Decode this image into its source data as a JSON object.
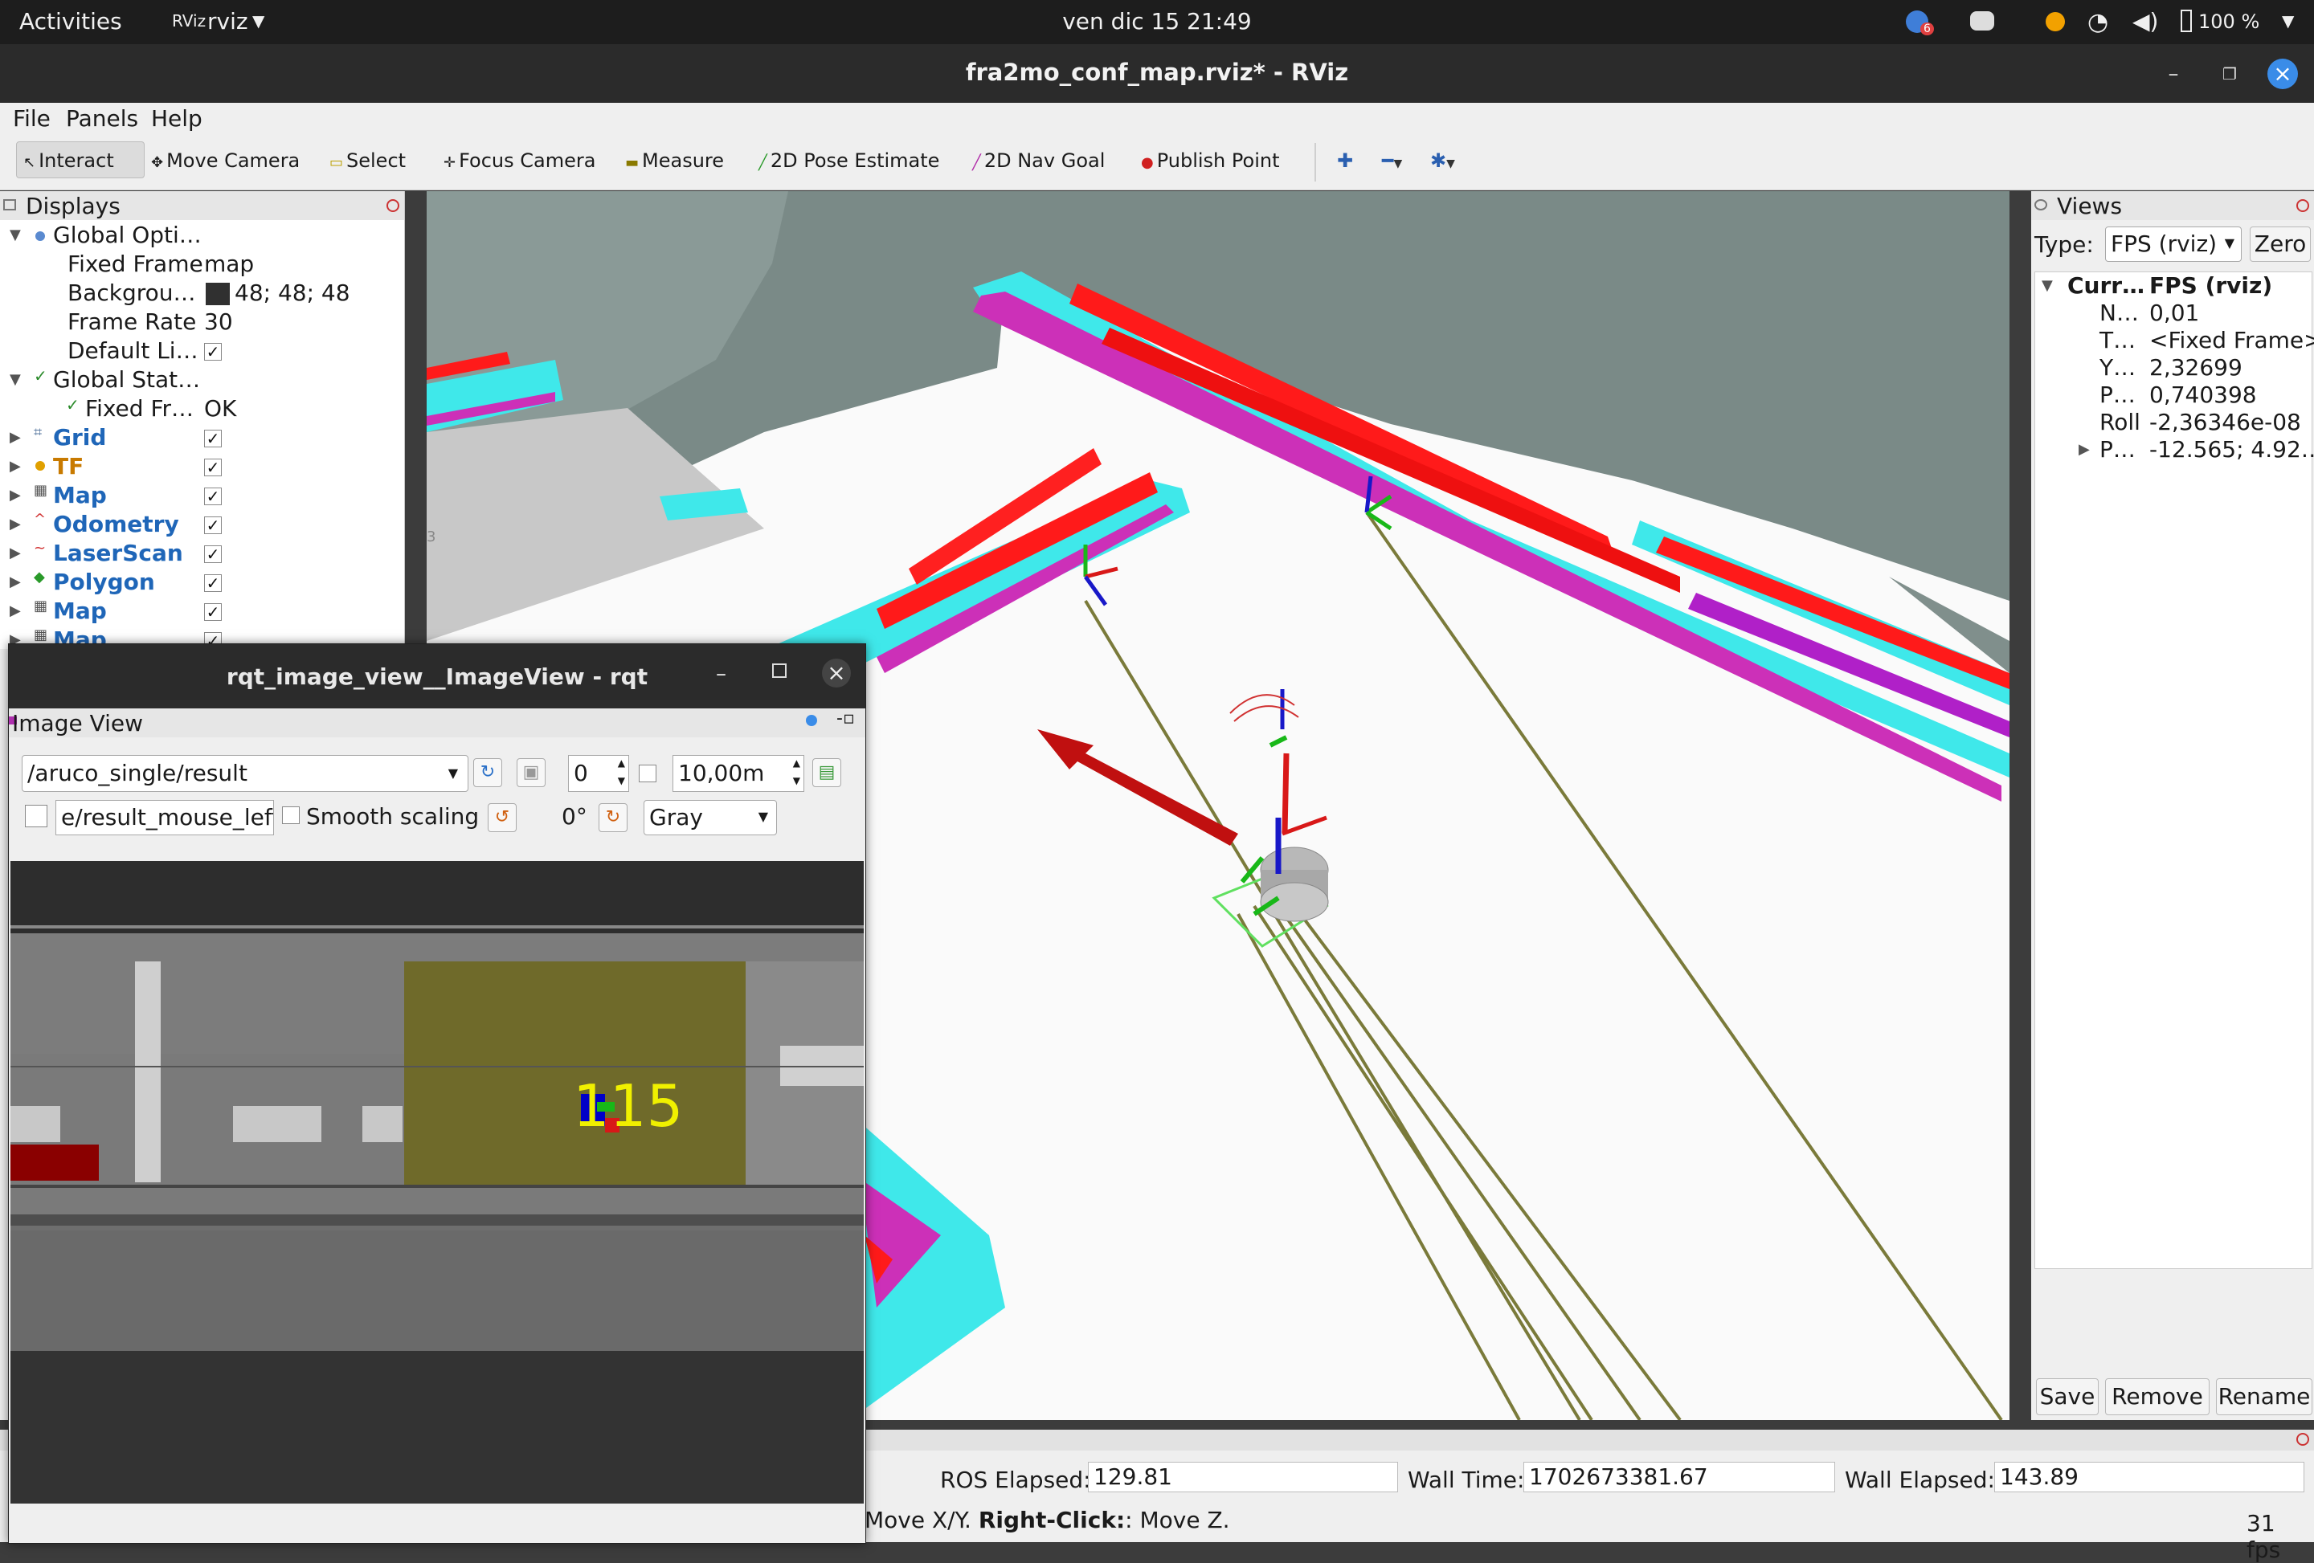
{
  "topbar": {
    "activities": "Activities",
    "app_name": "rviz",
    "clock": "ven dic 15  21:49",
    "battery": "100 %",
    "notif_count": "6"
  },
  "window": {
    "title": "fra2mo_conf_map.rviz* - RViz"
  },
  "menu": {
    "file": "File",
    "panels": "Panels",
    "help": "Help"
  },
  "toolbar": {
    "interact": "Interact",
    "move_camera": "Move Camera",
    "select": "Select",
    "focus_camera": "Focus Camera",
    "measure": "Measure",
    "pose_estimate": "2D Pose Estimate",
    "nav_goal": "2D Nav Goal",
    "publish_point": "Publish Point"
  },
  "displays": {
    "title": "Displays",
    "global_options": "Global Opti…",
    "fixed_frame_label": "Fixed Frame",
    "fixed_frame_value": "map",
    "background_label": "Backgrou…",
    "background_value": "48; 48; 48",
    "frame_rate_label": "Frame Rate",
    "frame_rate_value": "30",
    "default_light_label": "Default Li…",
    "global_status": "Global Stat…",
    "fixed_frame_status_label": "Fixed Fr…",
    "fixed_frame_status_value": "OK",
    "items": [
      {
        "label": "Grid",
        "color": "#1f66b8"
      },
      {
        "label": "TF",
        "color": "#c87a00"
      },
      {
        "label": "Map",
        "color": "#1f66b8"
      },
      {
        "label": "Odometry",
        "color": "#1f66b8"
      },
      {
        "label": "LaserScan",
        "color": "#1f66b8"
      },
      {
        "label": "Polygon",
        "color": "#1f66b8"
      },
      {
        "label": "Map",
        "color": "#1f66b8"
      },
      {
        "label": "Map",
        "color": "#1f66b8"
      }
    ]
  },
  "views": {
    "title": "Views",
    "type_label": "Type:",
    "type_value": "FPS (rviz)",
    "zero": "Zero",
    "current_label": "Curr…",
    "current_value": "FPS (rviz)",
    "props": [
      {
        "k": "N…",
        "v": "0,01"
      },
      {
        "k": "T…",
        "v": "<Fixed Frame>"
      },
      {
        "k": "Y…",
        "v": "2,32699"
      },
      {
        "k": "P…",
        "v": "0,740398"
      },
      {
        "k": "Roll",
        "v": "-2,36346e-08"
      },
      {
        "k": "P…",
        "v": "-12.565; 4.92…"
      }
    ],
    "save": "Save",
    "remove": "Remove",
    "rename": "Rename"
  },
  "status": {
    "ros_elapsed_label": "ROS Elapsed:",
    "ros_elapsed": "129.81",
    "wall_time_label": "Wall Time:",
    "wall_time": "1702673381.67",
    "wall_elapsed_label": "Wall Elapsed:",
    "wall_elapsed": "143.89",
    "hint_plain": "Move X/Y. ",
    "hint_bold": "Right-Click:",
    "hint_end": ": Move Z.",
    "fps": "31 fps"
  },
  "viewport": {
    "label_small": "3"
  },
  "rqt": {
    "title": "rqt_image_view__ImageView - rqt",
    "panel": "Image View",
    "topic": "/aruco_single/result",
    "spin_value": "0",
    "max_range": "10,00m",
    "mouse_topic": "e/result_mouse_left",
    "smooth": "Smooth scaling",
    "rotation": "0°",
    "colormap": "Gray",
    "marker_id": "115"
  }
}
